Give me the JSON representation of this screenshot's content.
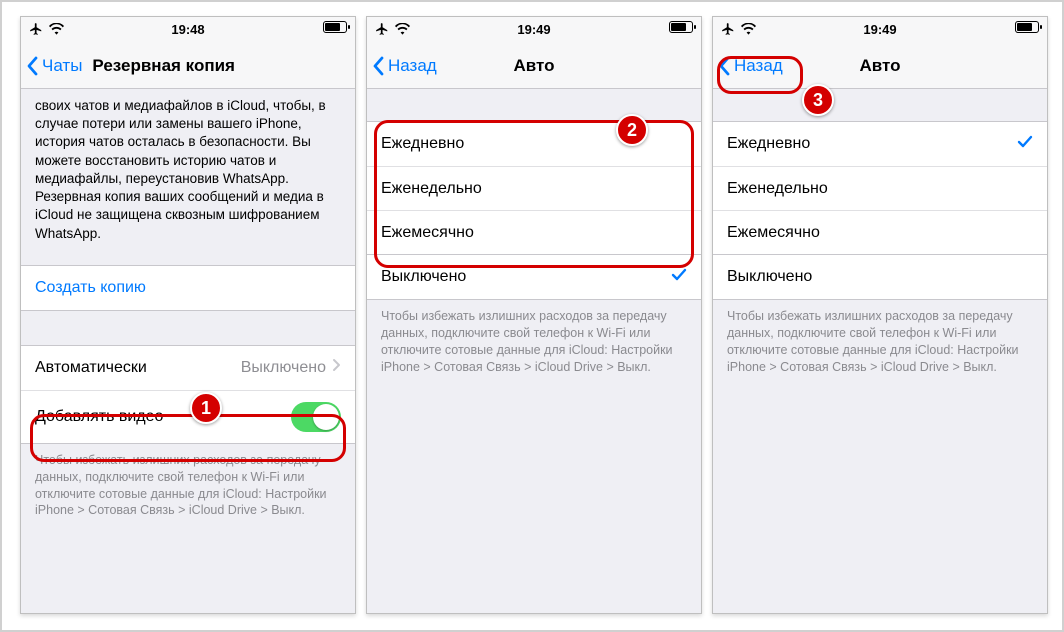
{
  "phones": {
    "p1": {
      "time": "19:48",
      "back_label": "Чаты",
      "title": "Резервная копия",
      "description": "своих чатов и медиафайлов в iCloud, чтобы, в случае потери или замены вашего iPhone, история чатов осталась в безопасности. Вы можете восстановить историю чатов и медиафайлы, переустановив WhatsApp. Резервная копия ваших сообщений и медиа в iCloud не защищена сквозным шифрованием WhatsApp.",
      "create_backup": "Создать копию",
      "auto_label": "Автоматически",
      "auto_value": "Выключено",
      "include_video": "Добавлять видео",
      "footnote": "Чтобы избежать излишних расходов за передачу данных, подключите свой телефон к Wi-Fi или отключите сотовые данные для iCloud: Настройки iPhone > Сотовая Cвязь > iCloud Drive > Выкл."
    },
    "p2": {
      "time": "19:49",
      "back_label": "Назад",
      "title": "Авто",
      "options": {
        "daily": "Ежедневно",
        "weekly": "Еженедельно",
        "monthly": "Ежемесячно",
        "off": "Выключено"
      },
      "selected": "off",
      "footnote": "Чтобы избежать излишних расходов за передачу данных, подключите свой телефон к Wi-Fi или отключите сотовые данные для iCloud: Настройки iPhone > Сотовая Cвязь > iCloud Drive > Выкл."
    },
    "p3": {
      "time": "19:49",
      "back_label": "Назад",
      "title": "Авто",
      "options": {
        "daily": "Ежедневно",
        "weekly": "Еженедельно",
        "monthly": "Ежемесячно",
        "off": "Выключено"
      },
      "selected": "daily",
      "footnote": "Чтобы избежать излишних расходов за передачу данных, подключите свой телефон к Wi-Fi или отключите сотовые данные для iCloud: Настройки iPhone > Сотовая Cвязь > iCloud Drive > Выкл."
    }
  },
  "badges": {
    "b1": "1",
    "b2": "2",
    "b3": "3"
  }
}
